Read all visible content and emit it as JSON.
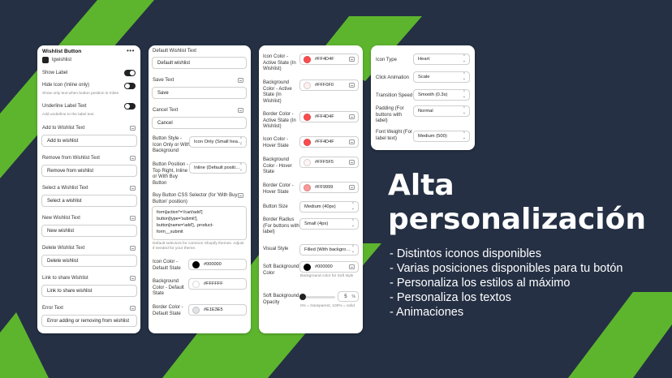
{
  "colors": {
    "background": "#253044",
    "brand_green": "#5db52e",
    "toggle_on": "#222222",
    "toggle_off": "#cccccc"
  },
  "panel1": {
    "title": "Wishlist Button",
    "app_name": "lgwishlist",
    "show_label": "Show Label",
    "hide_icon": "Hide Icon (Inline only)",
    "hide_icon_help": "Show only text when button position is Inline",
    "underline": "Underline Label Text",
    "underline_help": "Add underline to the label text",
    "add_label": "Add to Wishlist Text",
    "add_value": "Add to wishlist",
    "remove_label": "Remove from Wishlist Text",
    "remove_value": "Remove from wishlist",
    "select_label": "Select a Wishlist Text",
    "select_value": "Select a wishlist",
    "new_label": "New Wishlist Text",
    "new_value": "New wishlist",
    "delete_label": "Delete Wishlist Text",
    "delete_value": "Delete wishlist",
    "link_label": "Link to share Wishlist",
    "link_value": "Link to share wishlist",
    "error_label": "Error Text",
    "error_value": "Error adding or removing from wishlist"
  },
  "panel2": {
    "default_label": "Default Wishlist Text",
    "default_value": "Default wishlist",
    "save_label": "Save Text",
    "save_value": "Save",
    "cancel_label": "Cancel Text",
    "cancel_value": "Cancel",
    "style_label": "Button Style - Icon Only or With Background",
    "style_value": "Icon Only (Small hea…",
    "position_label": "Button Position - Top Right, Inline or With Buy Button",
    "position_value": "Inline (Default positi…",
    "css_label": "Buy Button CSS Selector (for 'With Buy Button' position)",
    "css_lines": [
      "form[action*='/cart/add']",
      "button[type='submit'],",
      "button[name='add'], .product-",
      "form__submit"
    ],
    "css_help": "Default selectors for common Shopify themes. Adjust if needed for your theme.",
    "icon_color_label": "Icon Color - Default State",
    "icon_color_value": "#000000",
    "bg_color_label": "Background Color - Default State",
    "bg_color_value": "#FFFFFF",
    "border_color_label": "Border Color - Default State",
    "border_color_value": "#E1E3E5"
  },
  "panel3": {
    "icon_active_label": "Icon Color - Active State (In Wishlist)",
    "icon_active_value": "#FF4D4F",
    "bg_active_label": "Background Color - Active State (In Wishlist)",
    "bg_active_value": "#FFF0F0",
    "border_active_label": "Border Color - Active State (In Wishlist)",
    "border_active_value": "#FF4D4F",
    "icon_hover_label": "Icon Color - Hover State",
    "icon_hover_value": "#FF4D4F",
    "bg_hover_label": "Background Color - Hover State",
    "bg_hover_value": "#FFF5F5",
    "border_hover_label": "Border Color - Hover State",
    "border_hover_value": "#FF9999",
    "size_label": "Button Size",
    "size_value": "Medium (40px)",
    "radius_label": "Border Radius (For buttons with label)",
    "radius_value": "Small (4px)",
    "visual_label": "Visual Style",
    "visual_value": "Filled (With backgro…",
    "soft_bg_label": "Soft Background Color",
    "soft_bg_value": "#000000",
    "soft_bg_help": "Background color for Soft style",
    "opacity_label": "Soft Background Opacity",
    "opacity_value": "5",
    "opacity_unit": "%",
    "opacity_level": 0.05,
    "opacity_help": "0% = transparent, 100% = solid"
  },
  "panel4": {
    "icon_type_label": "Icon Type",
    "icon_type_value": "Heart",
    "click_anim_label": "Click Animation",
    "click_anim_value": "Scale",
    "speed_label": "Transition Speed",
    "speed_value": "Smooth (0.3s)",
    "padding_label": "Padding (For buttons with label)",
    "padding_value": "Normal",
    "weight_label": "Font Weight (For label text)",
    "weight_value": "Medium (500)"
  },
  "promo": {
    "title_line1": "Alta",
    "title_line2": "personalización",
    "bullets": [
      "- Distintos iconos disponibles",
      "- Varias posiciones disponibles para tu botón",
      "- Personaliza los estilos al máximo",
      "- Personaliza los textos",
      "- Animaciones"
    ]
  },
  "icons": [
    "more-icon",
    "app-icon",
    "gear-icon",
    "chevron-icon"
  ]
}
